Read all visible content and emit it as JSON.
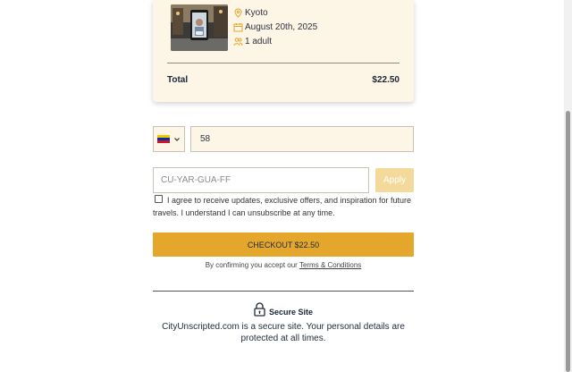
{
  "booking": {
    "city": "Kyoto",
    "date": "August 20th, 2025",
    "guests": "1 adult",
    "total_label": "Total",
    "total_value": "$22.50"
  },
  "phone": {
    "country": "Venezuela",
    "value": "58"
  },
  "promo": {
    "placeholder": "CU-YAR-GUA-FF",
    "apply_label": "Apply"
  },
  "consent": {
    "text": "I agree to receive updates, exclusive offers, and inspiration for future travels. I understand I can unsubscribe at any time."
  },
  "checkout": {
    "button_label": "CHECKOUT $22.50",
    "terms_prefix": "By confirming you accept our",
    "terms_link": "Terms & Conditions"
  },
  "secure": {
    "title": "Secure Site",
    "description": "CityUnscripted.com is a secure site. Your personal details are protected at all times."
  },
  "colors": {
    "accent": "#e4a72b",
    "card_bg": "#fdf5e6",
    "apply_disabled": "#f3d99a",
    "text_dark": "#1e2a38"
  }
}
